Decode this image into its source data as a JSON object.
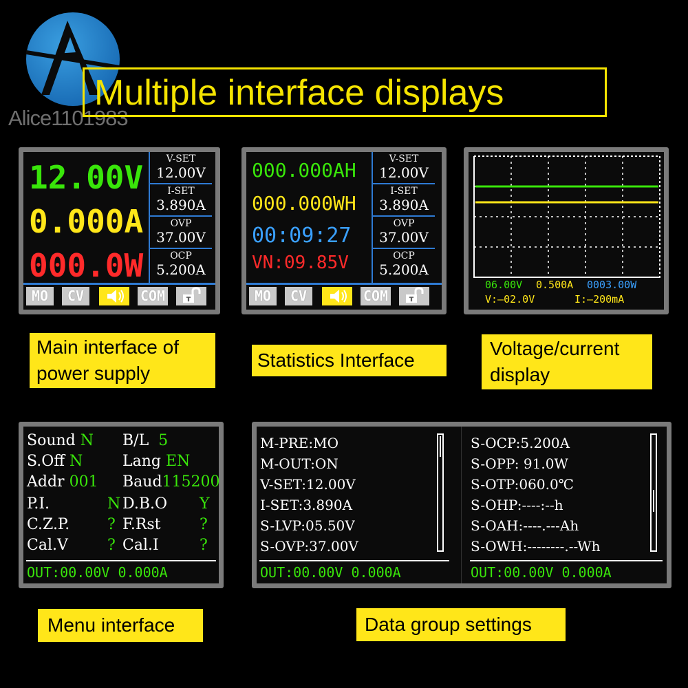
{
  "watermark": "Alice1101983",
  "title": "Multiple interface displays",
  "panel_main": {
    "voltage": "12.00V",
    "current": "0.000A",
    "power": "000.0W",
    "sets": [
      {
        "label": "V-SET",
        "value": "12.00V"
      },
      {
        "label": "I-SET",
        "value": "3.890A"
      },
      {
        "label": "OVP",
        "value": "37.00V"
      },
      {
        "label": "OCP",
        "value": "5.200A"
      }
    ],
    "buttons": [
      "MO",
      "CV",
      "",
      "COM",
      "T"
    ],
    "caption": "Main interface of power supply"
  },
  "panel_stats": {
    "ah": "000.000AH",
    "wh": "000.000WH",
    "time": "00:09:27",
    "vn": "VN:09.85V",
    "sets": [
      {
        "label": "V-SET",
        "value": "12.00V"
      },
      {
        "label": "I-SET",
        "value": "3.890A"
      },
      {
        "label": "OVP",
        "value": "37.00V"
      },
      {
        "label": "OCP",
        "value": "5.200A"
      }
    ],
    "buttons": [
      "MO",
      "CV",
      "",
      "COM",
      "T"
    ],
    "caption": "Statistics Interface"
  },
  "panel_scope": {
    "readout_v": "06.00V",
    "readout_a": "0.500A",
    "readout_w": "0003.00W",
    "scale_v": "V:—02.0V",
    "scale_i": "I:—200mA",
    "caption": "Voltage/current display",
    "colors": {
      "voltage": "#39e60a",
      "current": "#ffe619"
    }
  },
  "panel_menu": {
    "rows": [
      {
        "k1": "Sound",
        "v1": "N",
        "k2": "B/L",
        "v2": "5"
      },
      {
        "k1": "S.Off",
        "v1": "N",
        "k2": "Lang",
        "v2": "EN"
      },
      {
        "k1": "Addr",
        "v1": "001",
        "k2": "Baud",
        "v2": "115200"
      },
      {
        "k1": "P.I.",
        "v1": "N",
        "k2": "D.B.O",
        "v2": "Y"
      },
      {
        "k1": "C.Z.P.",
        "v1": "?",
        "k2": "F.Rst",
        "v2": "?"
      },
      {
        "k1": "Cal.V",
        "v1": "?",
        "k2": "Cal.I",
        "v2": "?"
      }
    ],
    "status": "OUT:00.00V  0.000A",
    "caption": "Menu interface"
  },
  "panel_data": {
    "left": [
      "M-PRE:MO",
      "M-OUT:ON",
      "V-SET:12.00V",
      "I-SET:3.890A",
      "S-LVP:05.50V",
      "S-OVP:37.00V"
    ],
    "right": [
      "S-OCP:5.200A",
      "S-OPP:  91.0W",
      "S-OTP:060.0℃",
      "S-OHP:----:--h",
      "S-OAH:----.---Ah",
      "S-OWH:--------.--Wh"
    ],
    "status": "OUT:00.00V  0.000A",
    "caption": "Data group settings"
  }
}
